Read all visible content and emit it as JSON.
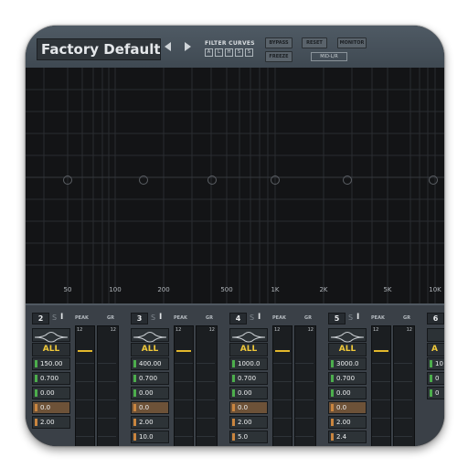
{
  "header": {
    "preset_name": "Factory Default",
    "filter_curves_label": "FILTER CURVES",
    "filter_curves_buttons": [
      "A",
      "L",
      "H",
      "S",
      "S"
    ],
    "bypass_label": "BYPASS",
    "reset_label": "RESET",
    "monitor_label": "MONITOR",
    "freeze_label": "FREEZE",
    "mode_label": "MID-L/R",
    "prev_icon": "left-arrow-icon",
    "next_icon": "right-arrow-icon"
  },
  "graph": {
    "freq_labels": [
      "50",
      "100",
      "200",
      "500",
      "1K",
      "2K",
      "5K",
      "10K"
    ]
  },
  "bands": [
    {
      "number": "2",
      "solo": "S",
      "bypass": "I",
      "peak_label": "PEAK",
      "gr_label": "GR",
      "channel": "ALL",
      "params": [
        "150.00",
        "0.700",
        "0.00",
        "0.0",
        "2.00"
      ],
      "meter_scale": [
        "12",
        "12"
      ]
    },
    {
      "number": "3",
      "solo": "S",
      "bypass": "I",
      "peak_label": "PEAK",
      "gr_label": "GR",
      "channel": "ALL",
      "params": [
        "400.00",
        "0.700",
        "0.00",
        "0.0",
        "2.00",
        "10.0"
      ],
      "meter_scale": [
        "12",
        "12"
      ]
    },
    {
      "number": "4",
      "solo": "S",
      "bypass": "I",
      "peak_label": "PEAK",
      "gr_label": "GR",
      "channel": "ALL",
      "params": [
        "1000.0",
        "0.700",
        "0.00",
        "0.0",
        "2.00",
        "5.0"
      ],
      "meter_scale": [
        "12",
        "12"
      ]
    },
    {
      "number": "5",
      "solo": "S",
      "bypass": "I",
      "peak_label": "PEAK",
      "gr_label": "GR",
      "channel": "ALL",
      "params": [
        "3000.0",
        "0.700",
        "0.00",
        "0.0",
        "2.00",
        "2.4"
      ],
      "meter_scale": [
        "12",
        "12"
      ]
    },
    {
      "number": "6",
      "solo": "",
      "bypass": "",
      "peak_label": "",
      "gr_label": "",
      "channel": "A",
      "params": [
        "10",
        "0",
        "0",
        "",
        "",
        ""
      ],
      "meter_scale": [
        "",
        ""
      ]
    }
  ],
  "colors": {
    "channel_text": "#f0c93a",
    "meter_level": "#e3b82c",
    "indicator_green": "#4cae4c",
    "indicator_orange": "#c9853f"
  }
}
